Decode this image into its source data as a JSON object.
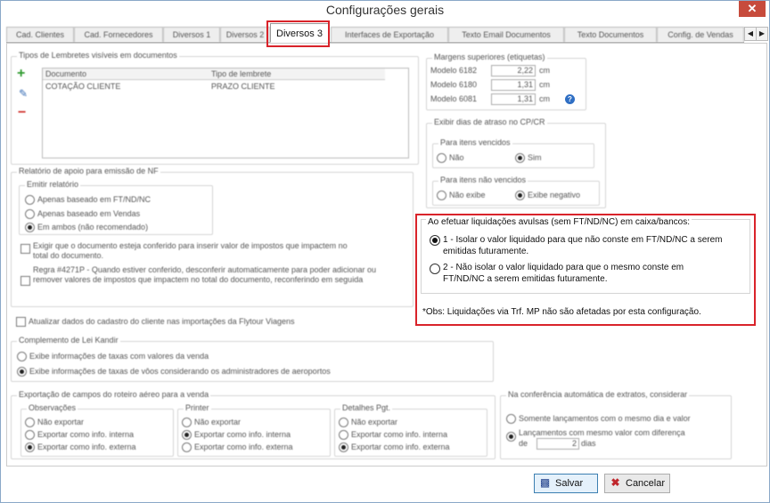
{
  "window": {
    "title": "Configurações gerais",
    "close_label": "✕"
  },
  "tabs": [
    {
      "label": "Cad. Clientes"
    },
    {
      "label": "Cad. Fornecedores"
    },
    {
      "label": "Diversos 1"
    },
    {
      "label": "Diversos 2"
    },
    {
      "label": "Diversos 3"
    },
    {
      "label": "Interfaces de Exportação"
    },
    {
      "label": "Texto Email Documentos"
    },
    {
      "label": "Texto Documentos"
    },
    {
      "label": "Config. de Vendas"
    }
  ],
  "scroll": {
    "left": "◀",
    "right": "▶"
  },
  "lembretes": {
    "title": "Tipos de Lembretes visíveis em documentos",
    "col_documento": "Documento",
    "col_tipo": "Tipo de lembrete",
    "row_documento": "COTAÇÃO CLIENTE",
    "row_tipo": "PRAZO CLIENTE",
    "add": "+",
    "edit": "✎",
    "remove": "−"
  },
  "margens": {
    "title": "Margens superiores (etiquetas)",
    "rows": [
      {
        "label": "Modelo 6182",
        "value": "2,22",
        "unit": "cm"
      },
      {
        "label": "Modelo 6180",
        "value": "1,31",
        "unit": "cm"
      },
      {
        "label": "Modelo 6081",
        "value": "1,31",
        "unit": "cm"
      }
    ],
    "help": "?"
  },
  "atraso": {
    "title": "Exibir dias de atraso no CP/CR",
    "vencidos_title": "Para itens vencidos",
    "vencidos_nao": "Não",
    "vencidos_sim": "Sim",
    "nao_vencidos_title": "Para itens não vencidos",
    "nv_nao_exibe": "Não exibe",
    "nv_exibe_negativo": "Exibe negativo"
  },
  "relatorio": {
    "title": "Relatório de apoio para emissão de NF",
    "emitir_title": "Emitir relatório",
    "opt1": "Apenas baseado em FT/ND/NC",
    "opt2": "Apenas baseado em Vendas",
    "opt3": "Em ambos (não recomendado)",
    "check1": "Exigir que o documento esteja conferido para inserir valor de impostos que impactem no total do documento.",
    "check2": "Regra #4271P - Quando estiver conferido, desconferir automaticamente para poder adicionar ou remover valores de impostos que impactem no total do documento, reconferindo em seguida"
  },
  "flytour": {
    "label": "Atualizar dados do cadastro do cliente nas importações da Flytour Viagens"
  },
  "kandir": {
    "title": "Complemento de Lei Kandir",
    "opt1": "Exibe informações de taxas com valores da venda",
    "opt2": "Exibe informações de taxas de vôos considerando os administradores de aeroportos"
  },
  "exportacao": {
    "title": "Exportação de campos do roteiro aéreo para a venda",
    "observacoes": {
      "title": "Observações",
      "opts": [
        "Não exportar",
        "Exportar como info. interna",
        "Exportar como info. externa"
      ]
    },
    "printer": {
      "title": "Printer",
      "opts": [
        "Não exportar",
        "Exportar como info. interna",
        "Exportar como info. externa"
      ]
    },
    "detalhes": {
      "title": "Detalhes Pgt.",
      "opts": [
        "Não exportar",
        "Exportar como info. interna",
        "Exportar como info. externa"
      ]
    }
  },
  "extratos": {
    "title": "Na conferência automática de extratos, considerar",
    "opt1": "Somente lançamentos com o mesmo dia e valor",
    "opt2": "Lançamentos com mesmo valor com diferença",
    "de": "de",
    "dias_value": "2",
    "dias": "dias"
  },
  "liquidacoes": {
    "title": "Ao efetuar liquidações avulsas (sem FT/ND/NC) em caixa/bancos:",
    "opt1_line1": "1 - Isolar o valor liquidado para que não conste em FT/ND/NC a serem",
    "opt1_line2": "emitidas futuramente.",
    "opt2_line1": "2 - Não isolar o valor liquidado para que o mesmo conste em",
    "opt2_line2": "FT/ND/NC a serem emitidas futuramente.",
    "obs": "*Obs: Liquidações via Trf. MP não são afetadas por esta configuração."
  },
  "footer": {
    "save": "Salvar",
    "cancel": "Cancelar"
  }
}
